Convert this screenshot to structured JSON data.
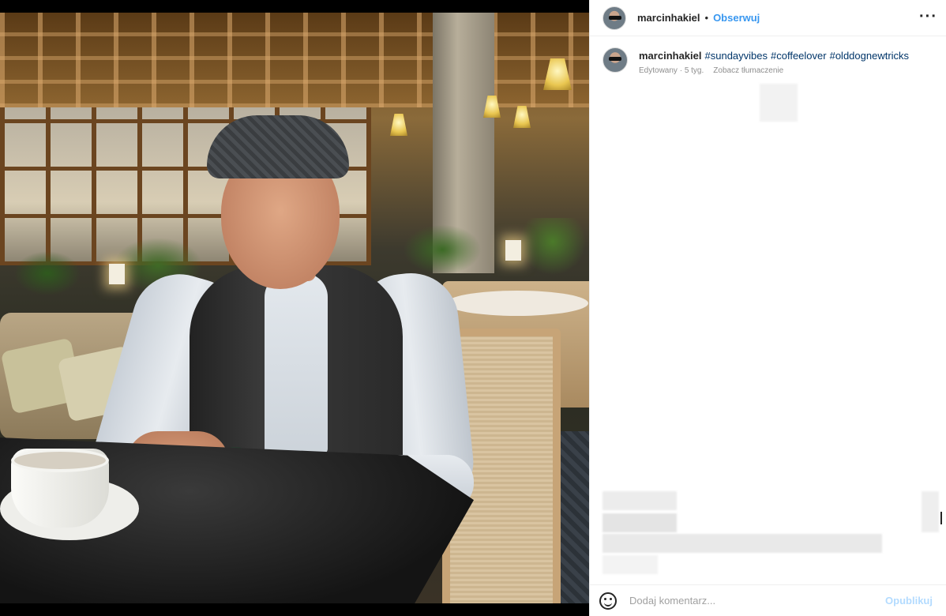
{
  "post": {
    "author": "marcinhakiel",
    "separator": "•",
    "follow_label": "Obserwuj",
    "more_label": "···"
  },
  "caption": {
    "author": "marcinhakiel",
    "hashtags": [
      "#sundayvibes",
      "#coffeelover",
      "#olddognewtricks"
    ],
    "edited_label": "Edytowany",
    "time_ago": "5 tyg.",
    "translate_label": "Zobacz tłumaczenie"
  },
  "comment_box": {
    "placeholder": "Dodaj komentarz...",
    "publish_label": "Opublikuj"
  },
  "icons": {
    "emoji": "smiley-icon",
    "more": "more-options-icon"
  },
  "colors": {
    "link_blue": "#3897f0",
    "hashtag": "#003569",
    "publish_disabled": "#b3dbff",
    "muted_text": "#8e8e8e"
  }
}
